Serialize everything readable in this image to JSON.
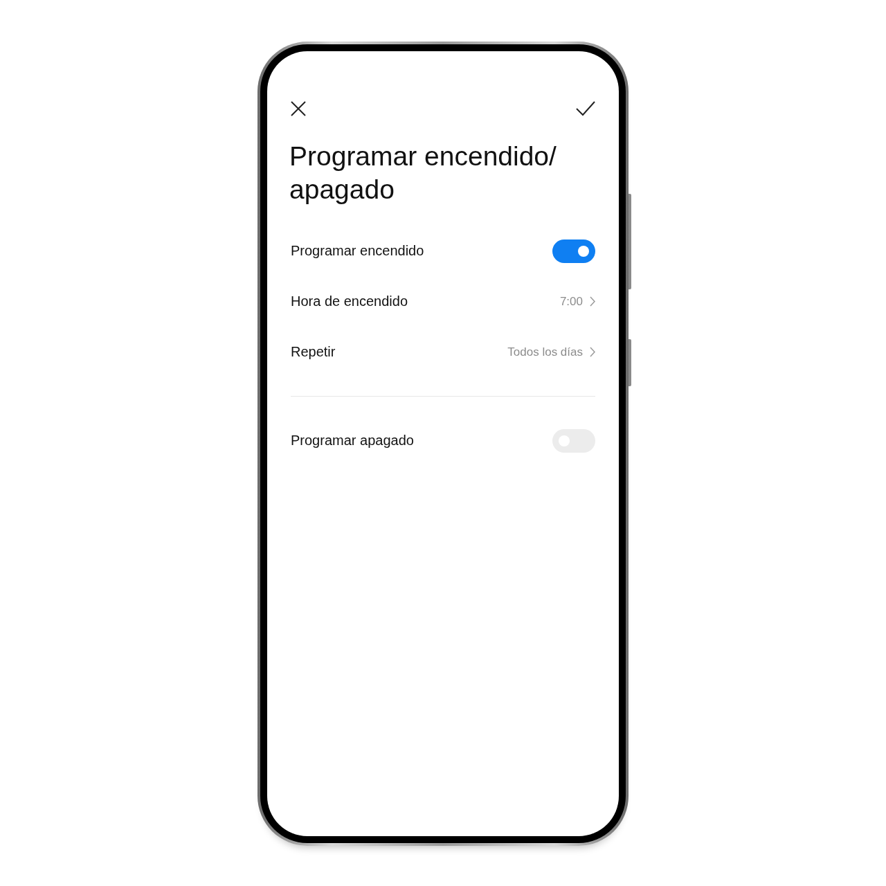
{
  "title": "Programar encendido/ apagado",
  "settings": [
    {
      "kind": "toggle",
      "label": "Programar encendido",
      "on": true
    },
    {
      "kind": "link",
      "label": "Hora de encendido",
      "value": "7:00"
    },
    {
      "kind": "link",
      "label": "Repetir",
      "value": "Todos los días"
    },
    {
      "kind": "divider"
    },
    {
      "kind": "toggle",
      "label": "Programar apagado",
      "on": false
    }
  ]
}
